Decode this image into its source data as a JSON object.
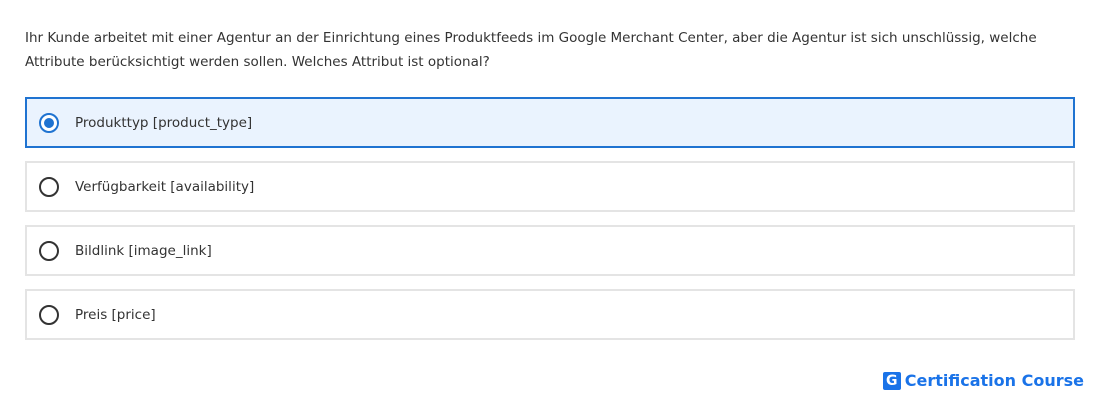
{
  "question": {
    "text": "Ihr Kunde arbeitet mit einer Agentur an der Einrichtung eines Produktfeeds im Google Merchant Center, aber die Agentur ist sich unschlüssig, welche Attribute berücksichtigt werden sollen. Welches Attribut ist optional?"
  },
  "options": [
    {
      "label": "Produkttyp [product_type]",
      "selected": true
    },
    {
      "label": "Verfügbarkeit [availability]",
      "selected": false
    },
    {
      "label": "Bildlink [image_link]",
      "selected": false
    },
    {
      "label": "Preis [price]",
      "selected": false
    }
  ],
  "brand": {
    "icon_letter": "G",
    "name": "Certification Course",
    "color": "#1a73e8"
  },
  "colors": {
    "selected_border": "#1f73d1",
    "selected_background": "#eaf3fe"
  }
}
